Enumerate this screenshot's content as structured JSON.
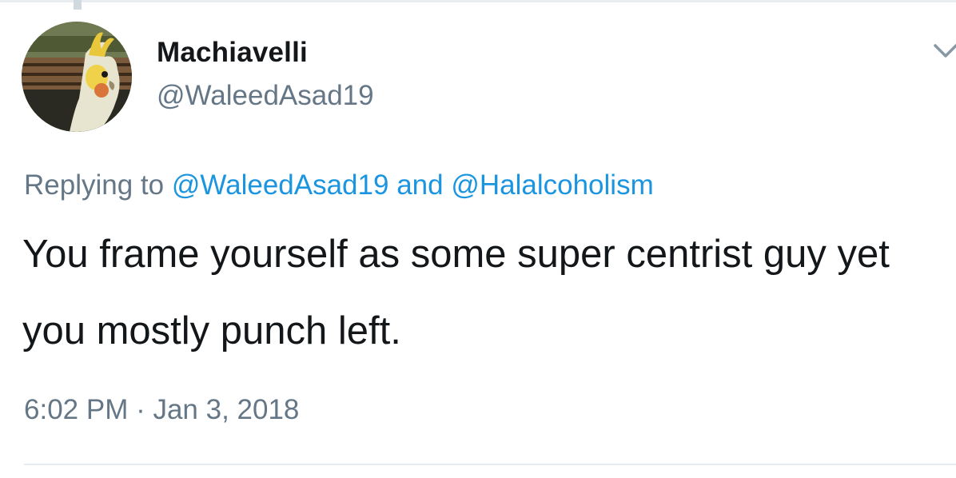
{
  "tweet": {
    "display_name": "Machiavelli",
    "handle": "@WaleedAsad19",
    "replying_prefix": "Replying to",
    "reply_mentions": [
      "@WaleedAsad19",
      "@Halalcoholism"
    ],
    "reply_joiner": "and",
    "text": "You frame yourself as some super centrist guy yet you mostly punch left.",
    "timestamp": "6:02 PM · Jan 3, 2018"
  },
  "icons": {
    "menu": "chevron-down-icon",
    "avatar": "cockatiel-avatar"
  },
  "colors": {
    "name": "#14171a",
    "secondary": "#657786",
    "link": "#1b95e0",
    "divider": "#e6ecf0"
  }
}
